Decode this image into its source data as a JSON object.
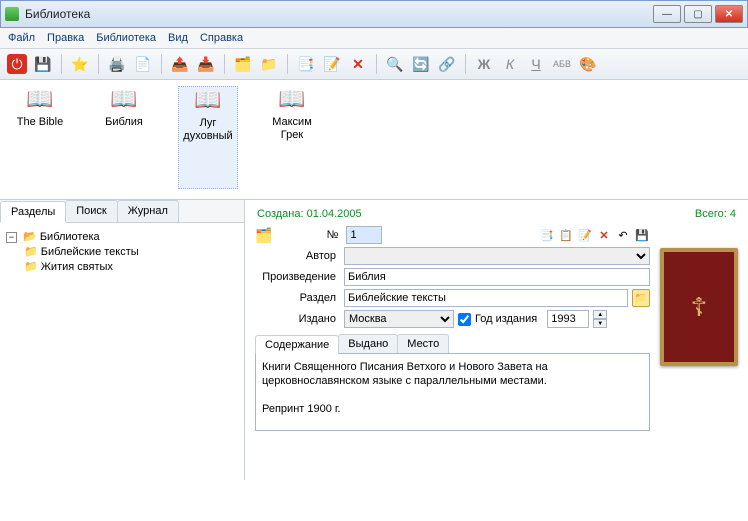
{
  "window": {
    "title": "Библиотека"
  },
  "menu": {
    "file": "Файл",
    "edit": "Правка",
    "library": "Библиотека",
    "view": "Вид",
    "help": "Справка"
  },
  "toolbar_format": {
    "bold": "Ж",
    "italic": "К",
    "underline": "Ч",
    "spell": "АБВ"
  },
  "shelf": [
    {
      "label": "The Bible"
    },
    {
      "label": "Библия"
    },
    {
      "label": "Луг духовный"
    },
    {
      "label": "Максим Грек"
    }
  ],
  "left_tabs": {
    "sections": "Разделы",
    "search": "Поиск",
    "journal": "Журнал"
  },
  "tree": {
    "root": "Библиотека",
    "children": [
      {
        "label": "Библейские тексты"
      },
      {
        "label": "Жития святых"
      }
    ]
  },
  "info": {
    "created_label": "Создана:",
    "created_value": "01.04.2005",
    "total_label": "Всего:",
    "total_value": "4"
  },
  "form": {
    "num_label": "№",
    "num_value": "1",
    "author_label": "Автор",
    "author_value": "",
    "work_label": "Произведение",
    "work_value": "Библия",
    "section_label": "Раздел",
    "section_value": "Библейские тексты",
    "published_label": "Издано",
    "published_value": "Москва",
    "year_check_label": "Год издания",
    "year_value": "1993"
  },
  "sub_tabs": {
    "content": "Содержание",
    "issued": "Выдано",
    "place": "Место"
  },
  "description": "Книги Священного Писания Ветхого и Нового Завета на церковнославянском языке с параллельными местами.\n\nРепринт 1900 г."
}
